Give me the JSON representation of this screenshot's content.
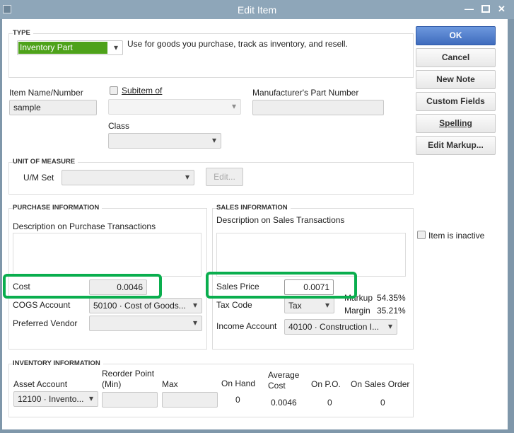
{
  "window": {
    "title": "Edit Item"
  },
  "type": {
    "label": "TYPE",
    "value": "Inventory Part",
    "description": "Use for goods you purchase, track as inventory, and resell."
  },
  "item": {
    "name_label": "Item Name/Number",
    "name_value": "sample",
    "subitem_label": "Subitem of",
    "mpn_label": "Manufacturer's Part Number",
    "class_label": "Class"
  },
  "uom": {
    "label": "UNIT OF MEASURE",
    "set_label": "U/M Set",
    "edit_button": "Edit..."
  },
  "purchase": {
    "label": "PURCHASE INFORMATION",
    "desc_label": "Description on Purchase Transactions",
    "cost_label": "Cost",
    "cost_value": "0.0046",
    "cogs_label": "COGS Account",
    "cogs_value": "50100 · Cost of Goods...",
    "vendor_label": "Preferred Vendor"
  },
  "sales": {
    "label": "SALES INFORMATION",
    "desc_label": "Description on Sales Transactions",
    "price_label": "Sales Price",
    "price_value": "0.0071",
    "tax_label": "Tax Code",
    "tax_value": "Tax",
    "markup_label": "Markup",
    "markup_value": "54.35%",
    "margin_label": "Margin",
    "margin_value": "35.21%",
    "income_label": "Income Account",
    "income_value": "40100 · Construction I..."
  },
  "inventory": {
    "label": "INVENTORY INFORMATION",
    "asset_label": "Asset Account",
    "asset_value": "12100 · Invento...",
    "reorder_label1": "Reorder Point",
    "reorder_label2": "(Min)",
    "max_label": "Max",
    "onhand_label": "On Hand",
    "onhand_value": "0",
    "avg_label1": "Average",
    "avg_label2": "Cost",
    "avg_value": "0.0046",
    "onpo_label": "On P.O.",
    "onpo_value": "0",
    "onso_label": "On Sales Order",
    "onso_value": "0"
  },
  "buttons": {
    "ok": "OK",
    "cancel": "Cancel",
    "new_note": "New Note",
    "custom_fields": "Custom Fields",
    "spelling": "Spelling",
    "edit_markup": "Edit Markup..."
  },
  "inactive_label": "Item is inactive",
  "colors": {
    "highlight": "#0aae4e",
    "type_bg": "#4ea21a",
    "ok_bg": "#4a78c8"
  }
}
